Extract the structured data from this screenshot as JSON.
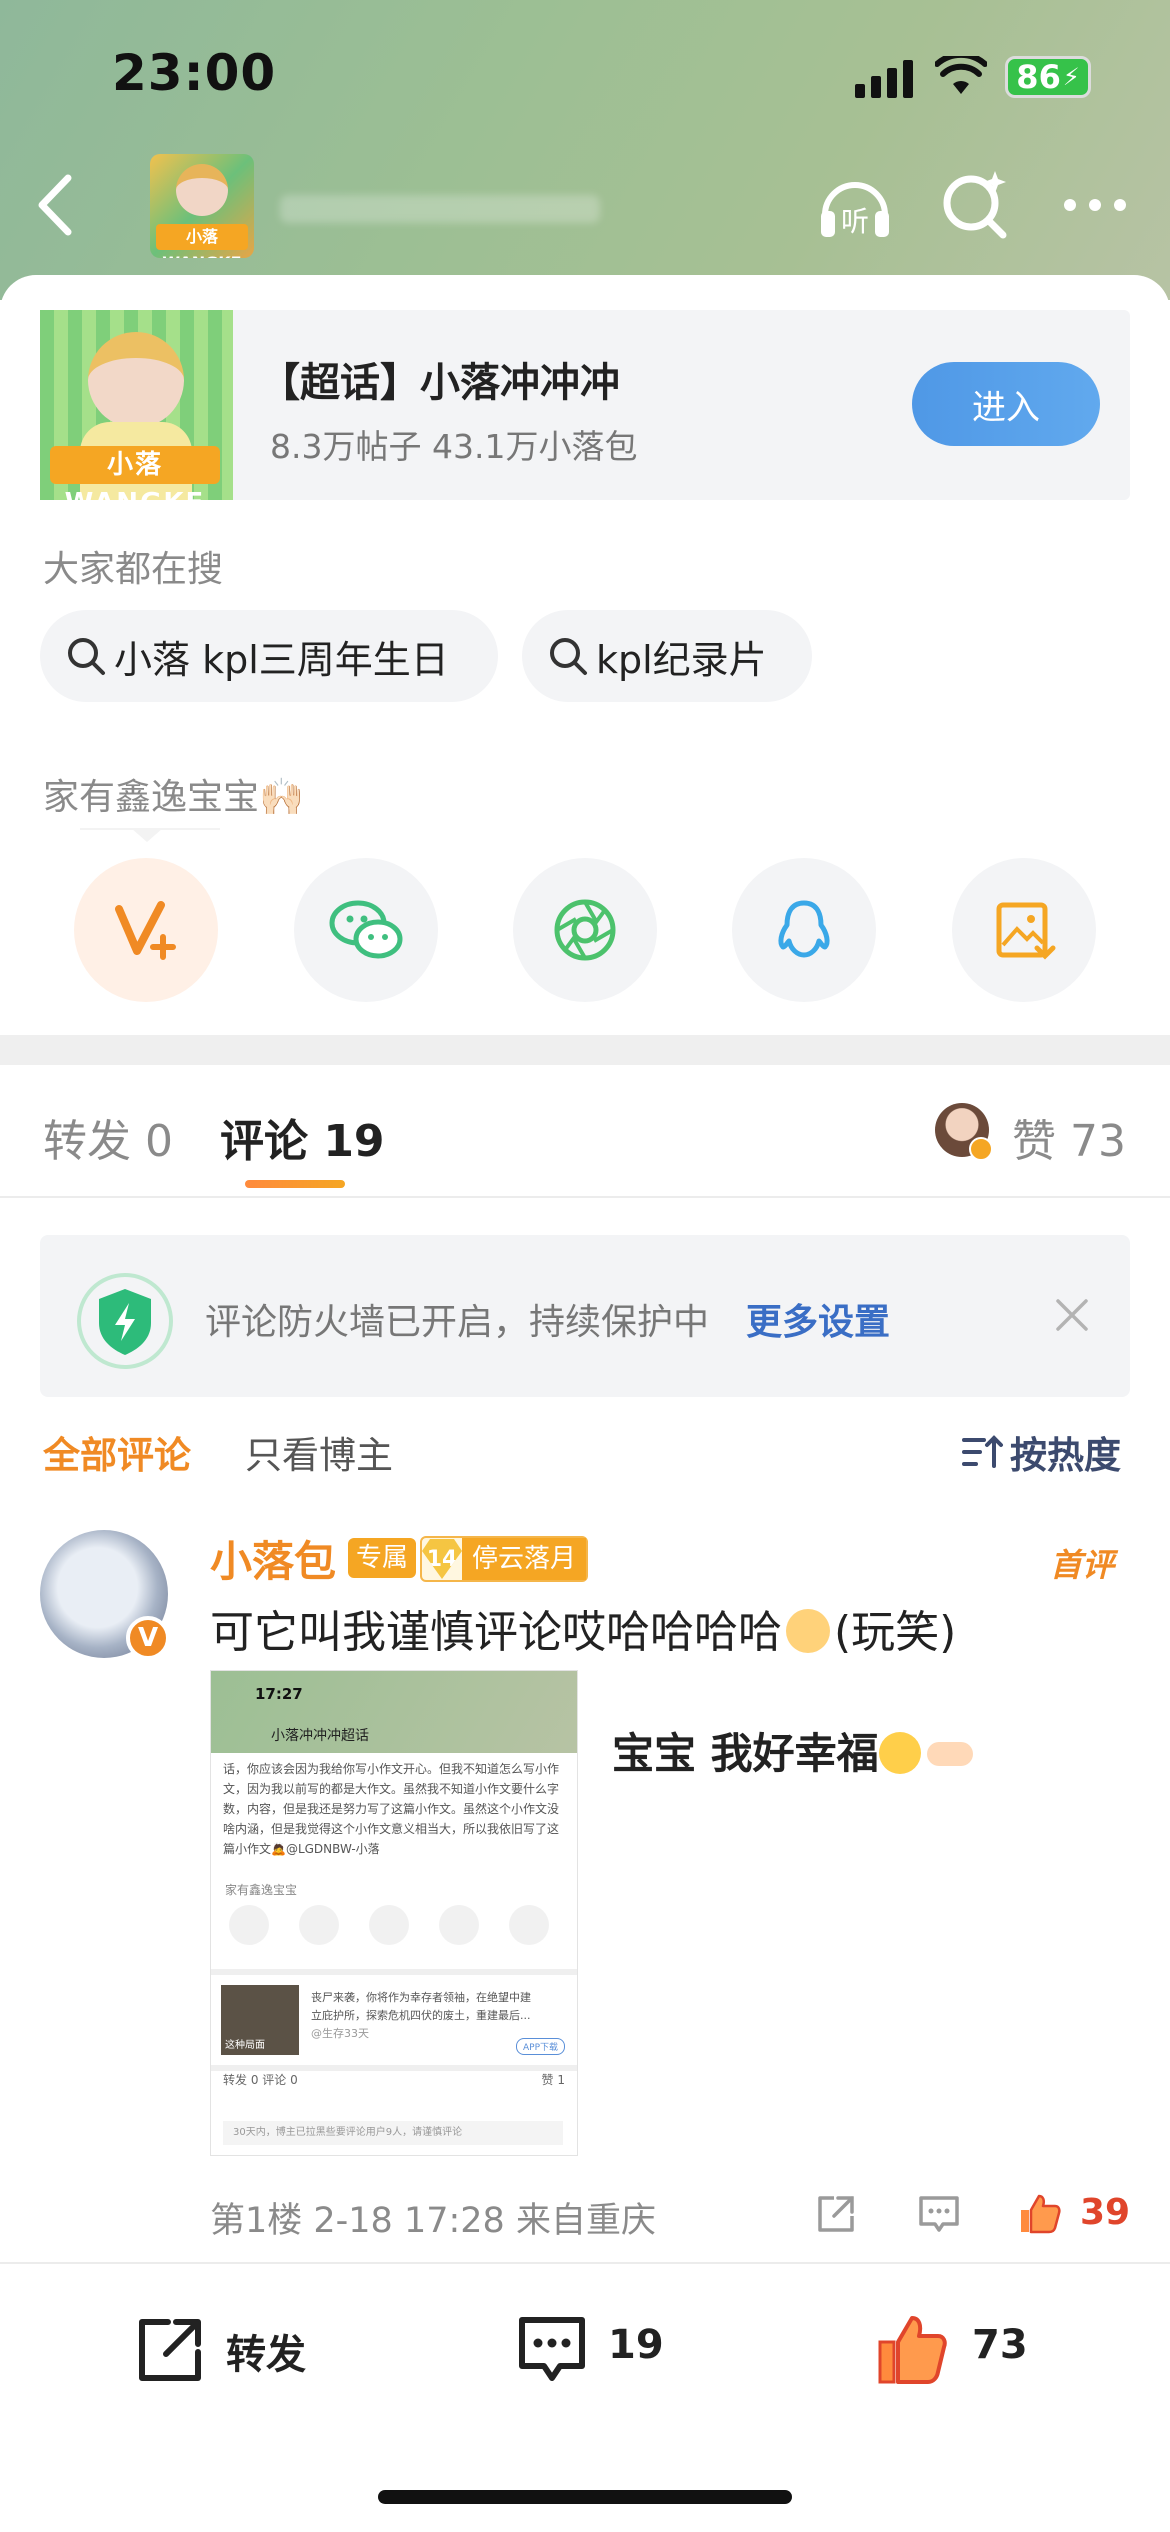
{
  "status": {
    "time": "23:00",
    "battery": "86"
  },
  "nav": {
    "back_icon": "chevron-left-icon",
    "listen_label": "听",
    "search_icon": "search-sparkle-icon",
    "more_icon": "more-dots-icon"
  },
  "topic": {
    "title": "【超话】小落冲冲冲",
    "stats": "8.3万帖子 43.1万小落包",
    "enter": "进入",
    "banner": "小落 WANGKE"
  },
  "search": {
    "label": "大家都在搜",
    "chips": [
      "小落 kpl三周年生日",
      "kpl纪录片"
    ]
  },
  "share": {
    "label": "家有鑫逸宝宝🙌🏻",
    "icons": [
      "weibo-v-plus-icon",
      "wechat-icon",
      "moments-icon",
      "qq-icon",
      "save-image-icon"
    ]
  },
  "tabs": {
    "repost": "转发 0",
    "comment": "评论 19",
    "like": "赞 73"
  },
  "firewall": {
    "text": "评论防火墙已开启，持续保护中",
    "link": "更多设置"
  },
  "filter": {
    "all": "全部评论",
    "owner": "只看博主",
    "sort": "按热度"
  },
  "comment": {
    "name": "小落包",
    "tag_exclusive": "专属",
    "fan_level": "14",
    "fan_group": "停云落月",
    "first_badge": "首评",
    "text_before": "可它叫我谨慎评论哎哈哈哈哈",
    "text_after": "(玩笑)",
    "side_text": "宝宝 我好幸福",
    "meta": "第1楼 2-18 17:28 来自重庆",
    "like_count": "39",
    "avatar_badge": "V"
  },
  "screenshot": {
    "time": "17:27",
    "title": "小落冲冲冲超话",
    "para": "话，你应该会因为我给你写小作文开心。但我不知道怎么写小作文，因为我以前写的都是大作文。虽然我不知道小作文要什么字数，内容，但是我还是努力写了这篇小作文。虽然这个小作文没啥内涵，但是我觉得这个小作文意义相当大，所以我依旧写了这篇小作文🙇@LGDNBW-小落",
    "section": "家有鑫逸宝宝",
    "ad_text": "丧尸来袭，你将作为幸存者领袖，在绝望中建立庇护所，探索危机四伏的废土，重建最后...",
    "ad_label": "这种局面",
    "ad_sub": "@生存33天",
    "ad_btn": "APP下载",
    "tabs": "转发 0   评论 0",
    "tab_like": "赞 1",
    "note": "30天内，博主已拉黑些要评论用户9人，请谨慎评论"
  },
  "bottom": {
    "repost": "转发",
    "comment_count": "19",
    "like_count": "73"
  }
}
